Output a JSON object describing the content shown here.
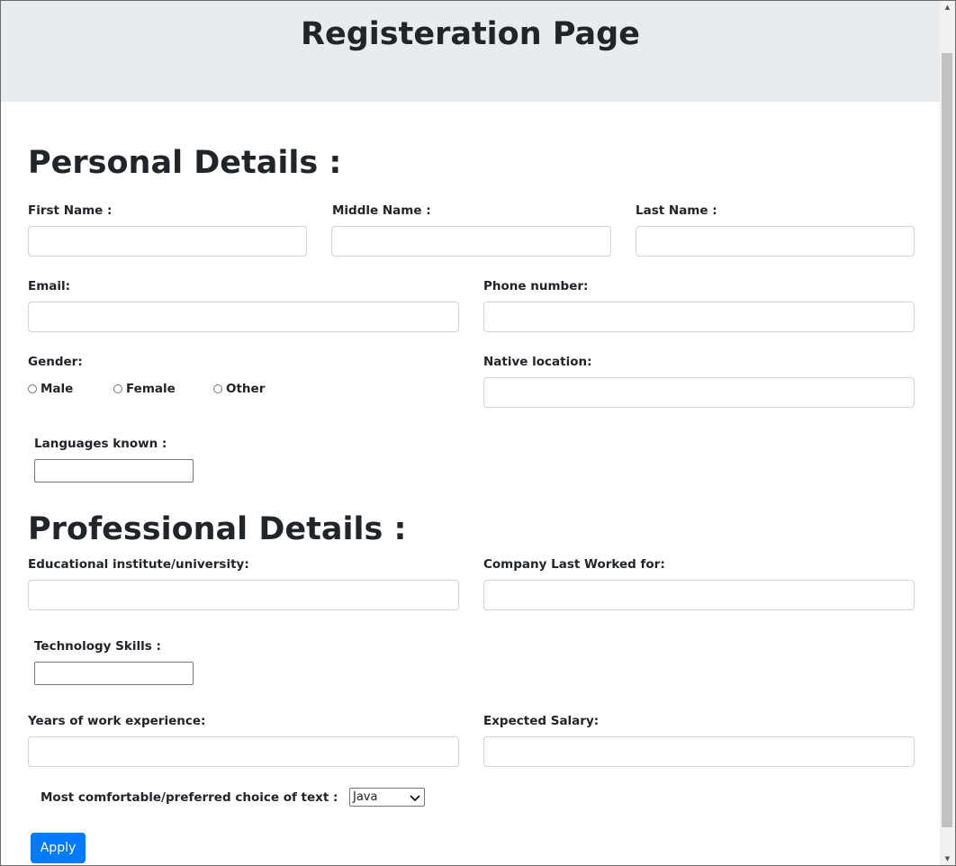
{
  "header": {
    "title": "Registeration Page"
  },
  "personal": {
    "title": "Personal Details :",
    "first_name_label": "First Name :",
    "middle_name_label": "Middle Name :",
    "last_name_label": "Last Name :",
    "email_label": "Email:",
    "phone_label": "Phone number:",
    "gender_label": "Gender:",
    "gender_options": [
      "Male",
      "Female",
      "Other"
    ],
    "native_location_label": "Native location:",
    "languages_label": "Languages known :"
  },
  "professional": {
    "title": "Professional Details :",
    "institute_label": "Educational institute/university:",
    "company_label": "Company Last Worked for:",
    "tech_skills_label": "Technology Skills :",
    "experience_label": "Years of work experience:",
    "salary_label": "Expected Salary:",
    "choice_label": "Most comfortable/preferred choice of text :",
    "choice_selected": "Java"
  },
  "actions": {
    "apply_label": "Apply"
  },
  "colors": {
    "header_bg": "#e9ecef",
    "primary": "#007bff"
  }
}
